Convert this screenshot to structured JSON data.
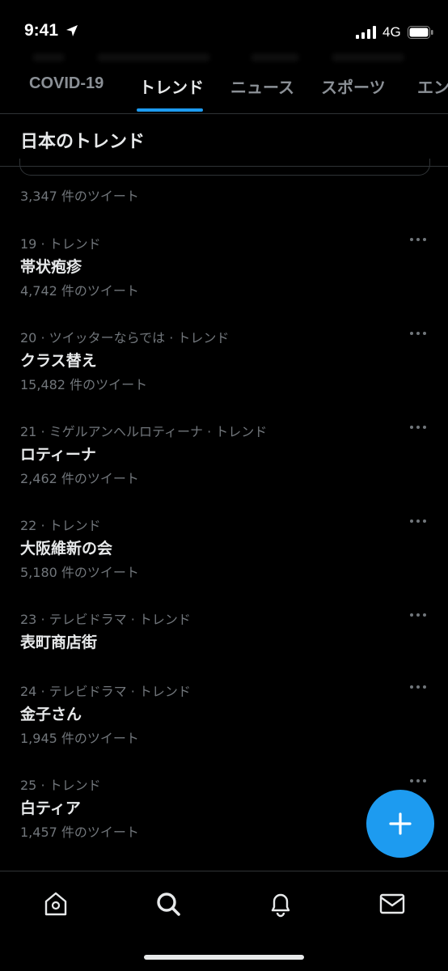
{
  "status_bar": {
    "time": "9:41",
    "network": "4G"
  },
  "tabs": [
    {
      "label": "COVID-19",
      "active": false
    },
    {
      "label": "トレンド",
      "active": true
    },
    {
      "label": "ニュース",
      "active": false
    },
    {
      "label": "スポーツ",
      "active": false
    },
    {
      "label": "エン",
      "active": false
    }
  ],
  "section": {
    "title": "日本のトレンド"
  },
  "previous_trend": {
    "count": "3,347 件のツイート"
  },
  "trends": [
    {
      "meta": "19 · トレンド",
      "name": "帯状疱疹",
      "count": "4,742 件のツイート"
    },
    {
      "meta": "20 · ツイッターならでは · トレンド",
      "name": "クラス替え",
      "count": "15,482 件のツイート"
    },
    {
      "meta": "21 · ミゲルアンヘルロティーナ · トレンド",
      "name": "ロティーナ",
      "count": "2,462 件のツイート"
    },
    {
      "meta": "22 · トレンド",
      "name": "大阪維新の会",
      "count": "5,180 件のツイート"
    },
    {
      "meta": "23 · テレビドラマ · トレンド",
      "name": "表町商店街",
      "count": ""
    },
    {
      "meta": "24 · テレビドラマ · トレンド",
      "name": "金子さん",
      "count": "1,945 件のツイート"
    },
    {
      "meta": "25 · トレンド",
      "name": "白ティア",
      "count": "1,457 件のツイート"
    }
  ],
  "icons": {
    "compose": "plus-icon",
    "nav": [
      "home-icon",
      "search-icon",
      "bell-icon",
      "mail-icon"
    ]
  },
  "colors": {
    "accent": "#1d9bf0",
    "background": "#000000",
    "secondary_text": "#71767b"
  }
}
